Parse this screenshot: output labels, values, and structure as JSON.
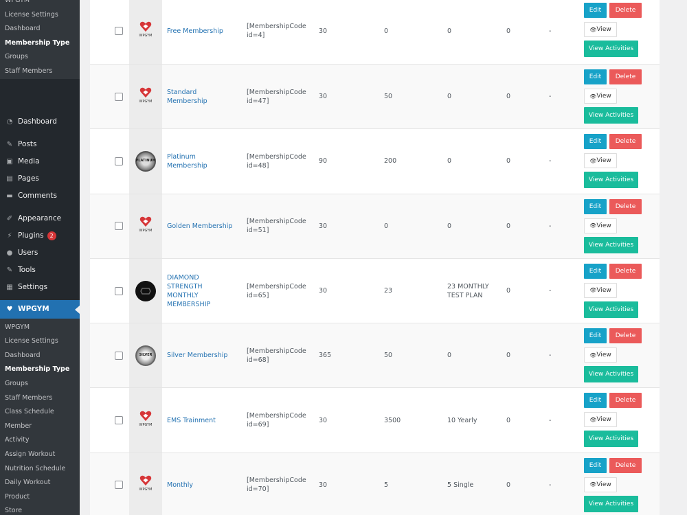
{
  "sidebar": {
    "top_submenu": [
      "WPGYM",
      "License Settings",
      "Dashboard",
      "Membership Type",
      "Groups",
      "Staff Members"
    ],
    "top_active_index": 3,
    "menu": [
      {
        "label": "Dashboard",
        "icon": "dashboard-icon"
      },
      {
        "label": "Posts",
        "icon": "pin-icon"
      },
      {
        "label": "Media",
        "icon": "media-icon"
      },
      {
        "label": "Pages",
        "icon": "pages-icon"
      },
      {
        "label": "Comments",
        "icon": "comment-icon"
      },
      {
        "label": "Appearance",
        "icon": "brush-icon"
      },
      {
        "label": "Plugins",
        "icon": "plugin-icon",
        "badge": "2"
      },
      {
        "label": "Users",
        "icon": "user-icon"
      },
      {
        "label": "Tools",
        "icon": "wrench-icon"
      },
      {
        "label": "Settings",
        "icon": "settings-icon"
      }
    ],
    "current_menu": {
      "label": "WPGYM",
      "icon": "heart-icon"
    },
    "bottom_submenu": [
      "WPGYM",
      "License Settings",
      "Dashboard",
      "Membership Type",
      "Groups",
      "Staff Members",
      "Class Schedule",
      "Member",
      "Activity",
      "Assign Workout",
      "Nutrition Schedule",
      "Daily Workout",
      "Product",
      "Store"
    ],
    "bottom_active_index": 3
  },
  "buttons": {
    "edit": "Edit",
    "delete": "Delete",
    "view": "View",
    "activities": "View Activities"
  },
  "rows": [
    {
      "logo": "wpgym",
      "name": "Free Membership",
      "code": "[MembershipCode id=4]",
      "c1": "30",
      "c2": "0",
      "c3": "0",
      "c4": "0",
      "c5": "-"
    },
    {
      "logo": "wpgym",
      "name": "Standard Membership",
      "code": "[MembershipCode id=47]",
      "c1": "30",
      "c2": "50",
      "c3": "0",
      "c4": "0",
      "c5": "-"
    },
    {
      "logo": "platinum",
      "name": "Platinum Membership",
      "code": "[MembershipCode id=48]",
      "c1": "90",
      "c2": "200",
      "c3": "0",
      "c4": "0",
      "c5": "-"
    },
    {
      "logo": "wpgym",
      "name": "Golden Membership",
      "code": "[MembershipCode id=51]",
      "c1": "30",
      "c2": "0",
      "c3": "0",
      "c4": "0",
      "c5": "-"
    },
    {
      "logo": "diamond",
      "name": "DIAMOND STRENGTH MONTHLY MEMBERSHIP",
      "code": "[MembershipCode id=65]",
      "c1": "30",
      "c2": "23",
      "c3": "23 MONTHLY TEST PLAN",
      "c4": "0",
      "c5": "-"
    },
    {
      "logo": "silver",
      "name": "Silver Membership",
      "code": "[MembershipCode id=68]",
      "c1": "365",
      "c2": "50",
      "c3": "0",
      "c4": "0",
      "c5": "-"
    },
    {
      "logo": "wpgym",
      "name": "EMS Trainment",
      "code": "[MembershipCode id=69]",
      "c1": "30",
      "c2": "3500",
      "c3": "10 Yearly",
      "c4": "0",
      "c5": "-"
    },
    {
      "logo": "wpgym",
      "name": "Monthly",
      "code": "[MembershipCode id=70]",
      "c1": "30",
      "c2": "5",
      "c3": "5 Single",
      "c4": "0",
      "c5": "-"
    }
  ],
  "logo_text": {
    "wpgym": "WPGYM",
    "platinum": "PLATINUM",
    "silver": "SILVER"
  },
  "colors": {
    "accent": "#2271b1",
    "edit": "#17a2c8",
    "delete": "#eb5a5a",
    "activities": "#1abc9c",
    "heart": "#d63638"
  }
}
